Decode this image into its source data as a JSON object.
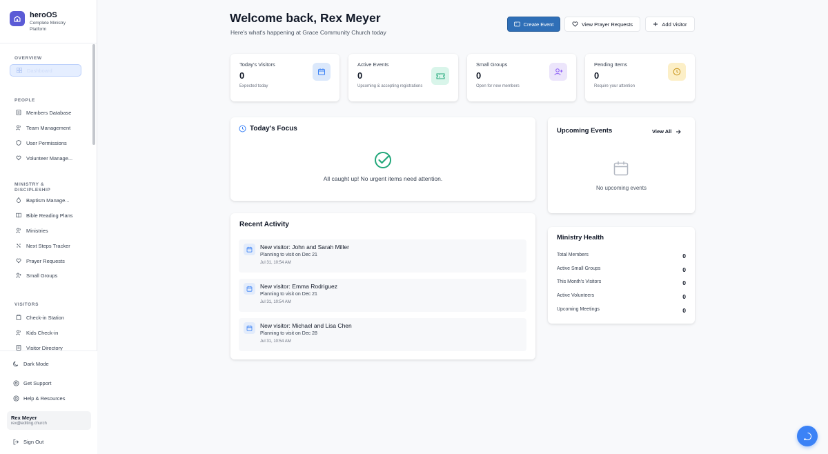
{
  "brand": {
    "name": "heroOS",
    "subtitle": "Complete Ministry Platform"
  },
  "sidebar": {
    "sections": [
      {
        "title": "OVERVIEW",
        "items": [
          {
            "label": "Dashboard",
            "icon": "dashboard-icon",
            "active": true
          }
        ]
      },
      {
        "title": "PEOPLE",
        "items": [
          {
            "label": "Members Database",
            "icon": "document-icon"
          },
          {
            "label": "Team Management",
            "icon": "users-icon"
          },
          {
            "label": "User Permissions",
            "icon": "shield-icon"
          },
          {
            "label": "Volunteer Manage...",
            "icon": "heart-hand-icon"
          }
        ]
      },
      {
        "title": "MINISTRY & DISCIPLESHIP",
        "items": [
          {
            "label": "Baptism Manage...",
            "icon": "droplet-icon"
          },
          {
            "label": "Bible Reading Plans",
            "icon": "book-icon"
          },
          {
            "label": "Ministries",
            "icon": "users-icon"
          },
          {
            "label": "Next Steps Tracker",
            "icon": "steps-icon"
          },
          {
            "label": "Prayer Requests",
            "icon": "heart-hand-icon"
          },
          {
            "label": "Small Groups",
            "icon": "user-plus-icon"
          }
        ]
      },
      {
        "title": "VISITORS",
        "items": [
          {
            "label": "Check-in Station",
            "icon": "clipboard-icon"
          },
          {
            "label": "Kids Check-in",
            "icon": "users-icon"
          },
          {
            "label": "Visitor Directory",
            "icon": "document-icon"
          }
        ]
      }
    ],
    "bottom": {
      "dark_mode": "Dark Mode",
      "support": "Get Support",
      "help": "Help & Resources",
      "sign_out": "Sign Out"
    },
    "user": {
      "name": "Rex Meyer",
      "email": "rex@editing.church"
    }
  },
  "header": {
    "title": "Welcome back, Rex Meyer",
    "subtitle": "Here's what's happening at Grace Community Church today",
    "buttons": {
      "create_event": "Create Event",
      "view_prayer": "View Prayer Requests",
      "add_visitor": "Add Visitor"
    }
  },
  "stats": [
    {
      "title": "Today's Visitors",
      "value": "0",
      "note": "Expected today",
      "icon": "calendar-icon",
      "color": "#3b82f6",
      "bg": "#dbe8fb"
    },
    {
      "title": "Active Events",
      "value": "0",
      "note": "Upcoming & accepting registrations",
      "icon": "ticket-icon",
      "color": "#22a77a",
      "bg": "#d9f5ea"
    },
    {
      "title": "Small Groups",
      "value": "0",
      "note": "Open for new members",
      "icon": "user-plus-icon",
      "color": "#8b5cf6",
      "bg": "#ece5fb"
    },
    {
      "title": "Pending Items",
      "value": "0",
      "note": "Require your attention",
      "icon": "clock-icon",
      "color": "#c9961e",
      "bg": "#fcefc7"
    }
  ],
  "focus": {
    "title": "Today's Focus",
    "message": "All caught up! No urgent items need attention."
  },
  "upcoming": {
    "title": "Upcoming Events",
    "view_all": "View All",
    "empty": "No upcoming events"
  },
  "activity": {
    "title": "Recent Activity",
    "items": [
      {
        "title": "New visitor: John and Sarah Miller",
        "sub": "Planning to visit on Dec 21",
        "time": "Jul 31, 10:54 AM"
      },
      {
        "title": "New visitor: Emma Rodriguez",
        "sub": "Planning to visit on Dec 21",
        "time": "Jul 31, 10:54 AM"
      },
      {
        "title": "New visitor: Michael and Lisa Chen",
        "sub": "Planning to visit on Dec 28",
        "time": "Jul 31, 10:54 AM"
      }
    ]
  },
  "health": {
    "title": "Ministry Health",
    "rows": [
      {
        "label": "Total Members",
        "value": "0"
      },
      {
        "label": "Active Small Groups",
        "value": "0"
      },
      {
        "label": "This Month's Visitors",
        "value": "0"
      },
      {
        "label": "Active Volunteers",
        "value": "0"
      },
      {
        "label": "Upcoming Meetings",
        "value": "0"
      }
    ]
  },
  "colors": {
    "accent": "#2f6fb7",
    "fab": "#3b82f6",
    "success": "#22a77a"
  }
}
